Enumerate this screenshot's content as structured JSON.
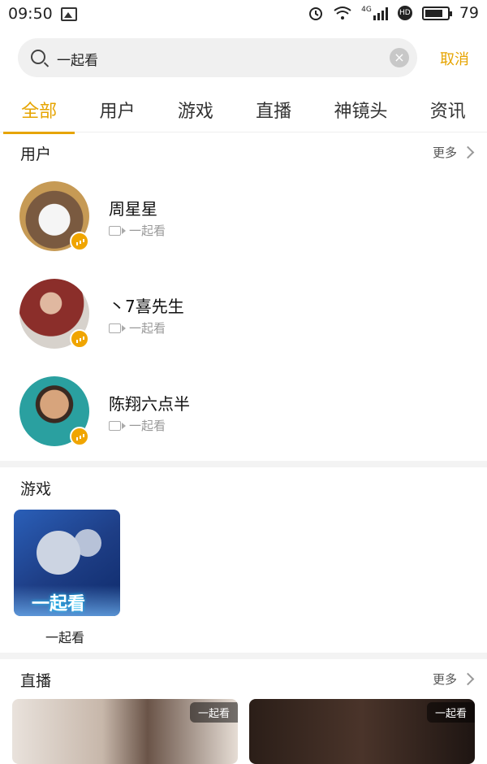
{
  "status": {
    "time": "09:50",
    "battery": "79",
    "network": "4G",
    "hd": "HD"
  },
  "search": {
    "query": "一起看",
    "cancel_label": "取消",
    "clear_symbol": "×"
  },
  "tabs": [
    {
      "label": "全部",
      "active": true
    },
    {
      "label": "用户"
    },
    {
      "label": "游戏"
    },
    {
      "label": "直播"
    },
    {
      "label": "神镜头"
    },
    {
      "label": "资讯"
    }
  ],
  "users_section": {
    "title": "用户",
    "more_label": "更多",
    "items": [
      {
        "name": "周星星",
        "subtitle": "一起看"
      },
      {
        "name": "丶7喜先生",
        "subtitle": "一起看"
      },
      {
        "name": "陈翔六点半",
        "subtitle": "一起看"
      }
    ]
  },
  "games_section": {
    "title": "游戏",
    "items": [
      {
        "label": "一起看",
        "thumb_text": "一起看"
      }
    ]
  },
  "live_section": {
    "title": "直播",
    "more_label": "更多",
    "cards": [
      {
        "tag": "一起看"
      },
      {
        "tag": "一起看"
      }
    ]
  },
  "colors": {
    "accent": "#e6a400",
    "badge": "#f0a500"
  }
}
